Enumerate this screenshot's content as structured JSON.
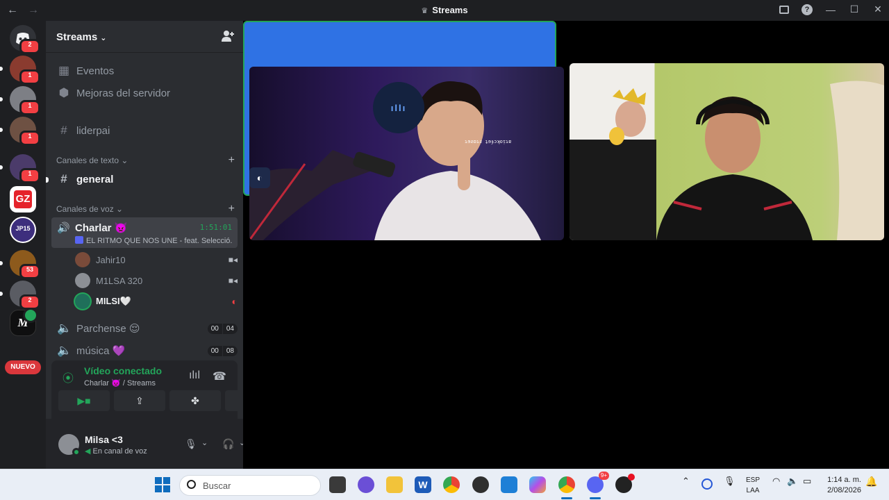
{
  "titlebar": {
    "title": "Streams",
    "back": "←",
    "forward": "→"
  },
  "servers": [
    {
      "name": "discord-home",
      "badge": "2",
      "color": "#313338"
    },
    {
      "name": "server-1",
      "badge": "1",
      "color": "#8a3b2f"
    },
    {
      "name": "server-2",
      "badge": "1",
      "color": "#7d7f85"
    },
    {
      "name": "server-3",
      "badge": "1",
      "color": "#6e5143"
    },
    {
      "name": "server-4",
      "badge": "1",
      "color": "#4b3b6a"
    },
    {
      "name": "server-gz",
      "badge": "",
      "color": "#e5232b"
    },
    {
      "name": "server-jp15",
      "badge": "",
      "color": "#3d2e7d"
    },
    {
      "name": "server-5",
      "badge": "53",
      "color": "#8d5a1c"
    },
    {
      "name": "server-6",
      "badge": "2",
      "color": "#5a5c63"
    },
    {
      "name": "server-m",
      "badge": "",
      "color": "#0f0f10"
    }
  ],
  "server_rail_new": "NUEVO",
  "server_header": {
    "name": "Streams"
  },
  "channels": {
    "eventos": "Eventos",
    "mejoras": "Mejoras del servidor",
    "liderpai": "liderpai",
    "text_category": "Canales de texto",
    "general": "general",
    "voice_category": "Canales de voz",
    "active_voice": {
      "name": "Charlar 👿",
      "time": "1:51:01",
      "status": "EL RITMO QUE NOS UNE - feat. Selecció..."
    },
    "voice_users": [
      {
        "name": "Jahir10",
        "icon": "video-icon",
        "color": "#7a4b3a"
      },
      {
        "name": "M1LSA 320",
        "icon": "video-icon",
        "color": "#8c8f95"
      },
      {
        "name": "MILSI🤍",
        "icon": "activity-icon",
        "color": "#1f6f5a"
      }
    ],
    "parchense": {
      "name": "Parchense 😌",
      "a": "00",
      "b": "04"
    },
    "musica": {
      "name": "música 💜",
      "a": "00",
      "b": "08"
    }
  },
  "rtc": {
    "status": "Vídeo conectado",
    "channel": "Charlar 👿 / Streams"
  },
  "user": {
    "name": "Milsa <3",
    "status": "En canal de voz",
    "avatar_color": "#8c8f95"
  },
  "stage": {
    "tile_a_overlay": "ɿɘƨɒɿƨ ʇɘɟɔʞoᴉɿɐ",
    "speaker_glyph": "ıllı",
    "colors": {
      "tile_c": "#2f72e4",
      "speaking_border": "#23a55a"
    }
  },
  "taskbar": {
    "search_placeholder": "Buscar",
    "lang_top": "ESP",
    "lang_bottom": "LAA",
    "time": "1:14 a. m.",
    "date": "2/08/2026",
    "discord_badge": "9+"
  }
}
